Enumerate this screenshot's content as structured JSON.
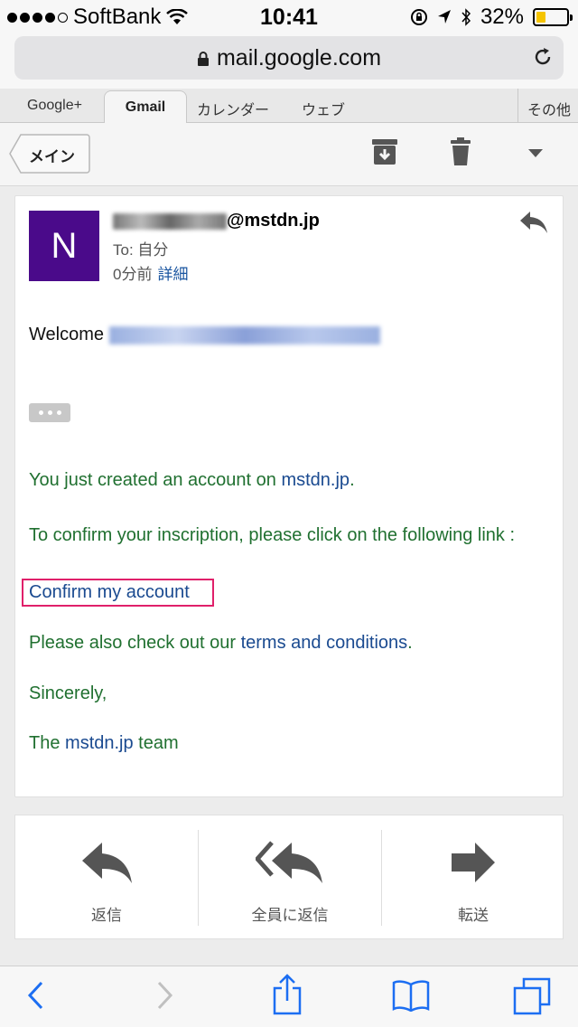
{
  "status_bar": {
    "carrier": "SoftBank",
    "time": "10:41",
    "battery": "32%",
    "battery_level": 0.32
  },
  "browser": {
    "url": "mail.google.com"
  },
  "tabs": {
    "items": [
      "Google+",
      "Gmail",
      "カレンダー",
      "ウェブ"
    ],
    "active": "Gmail",
    "more": "その他"
  },
  "toolbar": {
    "back_label": "メイン"
  },
  "email": {
    "avatar_letter": "N",
    "sender_visible": "@mstdn.jp",
    "to": "To: 自分",
    "time": "0分前",
    "details": "詳細",
    "welcome": "Welcome",
    "line1_prefix": "You just created an account on ",
    "line1_link": "mstdn.jp",
    "line1_suffix": ".",
    "line2": "To confirm your inscription, please click on the following link :",
    "confirm_link": "Confirm my account",
    "line3_prefix": "Please also check out our ",
    "line3_link": "terms and conditions",
    "line3_suffix": ".",
    "line4": "Sincerely,",
    "line5_prefix": "The ",
    "line5_link": "mstdn.jp",
    "line5_suffix": " team"
  },
  "actions": {
    "reply": "返信",
    "reply_all": "全員に返信",
    "forward": "転送"
  },
  "colors": {
    "avatar": "#4a0a8a",
    "text_green": "#207030",
    "link_blue": "#1a4a90",
    "highlight": "#e0206a"
  }
}
